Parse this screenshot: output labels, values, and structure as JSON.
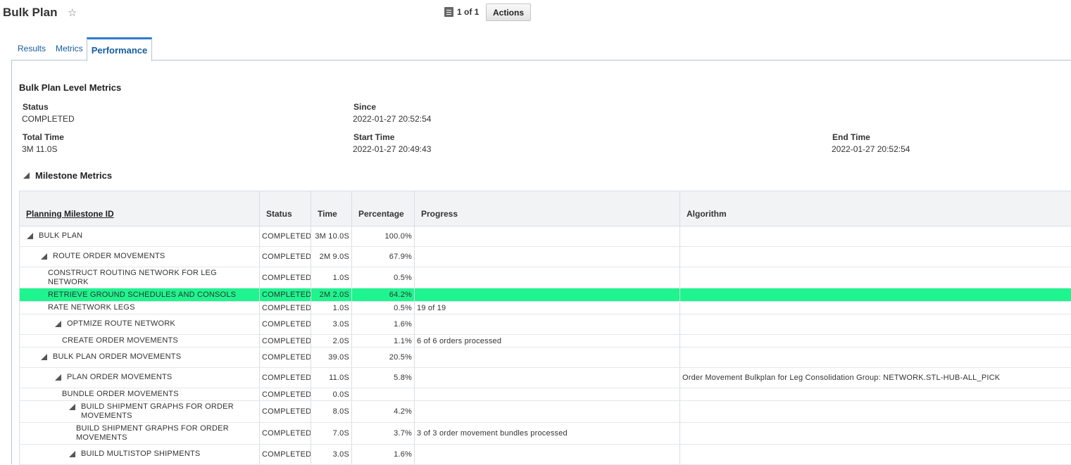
{
  "header": {
    "title": "Bulk Plan",
    "pager_text": "1 of 1",
    "actions_label": "Actions"
  },
  "tabs": [
    {
      "label": "Results",
      "active": false
    },
    {
      "label": "Metrics",
      "active": false
    },
    {
      "label": "Performance",
      "active": true
    }
  ],
  "bulk_plan_metrics": {
    "title": "Bulk Plan Level Metrics",
    "status_label": "Status",
    "status_value": "COMPLETED",
    "since_label": "Since",
    "since_value": "2022-01-27 20:52:54",
    "total_time_label": "Total Time",
    "total_time_value": "3M 11.0S",
    "start_time_label": "Start Time",
    "start_time_value": "2022-01-27 20:49:43",
    "end_time_label": "End Time",
    "end_time_value": "2022-01-27 20:52:54"
  },
  "milestone": {
    "title": "Milestone Metrics",
    "columns": [
      "Planning Milestone ID",
      "Status",
      "Time",
      "Percentage",
      "Progress",
      "Algorithm"
    ],
    "rows": [
      {
        "id": "BULK PLAN",
        "level": 0,
        "expandable": true,
        "status": "COMPLETED",
        "time": "3M 10.0S",
        "percentage": "100.0%",
        "progress": "",
        "algorithm": "",
        "highlight": false
      },
      {
        "id": "ROUTE ORDER MOVEMENTS",
        "level": 1,
        "expandable": true,
        "status": "COMPLETED",
        "time": "2M 9.0S",
        "percentage": "67.9%",
        "progress": "",
        "algorithm": "",
        "highlight": false
      },
      {
        "id": "CONSTRUCT ROUTING NETWORK FOR LEG NETWORK",
        "level": 2,
        "expandable": false,
        "status": "COMPLETED",
        "time": "1.0S",
        "percentage": "0.5%",
        "progress": "",
        "algorithm": "",
        "highlight": false
      },
      {
        "id": "RETRIEVE GROUND SCHEDULES AND CONSOLS",
        "level": 2,
        "expandable": false,
        "status": "COMPLETED",
        "time": "2M 2.0S",
        "percentage": "64.2%",
        "progress": "",
        "algorithm": "",
        "highlight": true
      },
      {
        "id": "RATE NETWORK LEGS",
        "level": 2,
        "expandable": false,
        "status": "COMPLETED",
        "time": "1.0S",
        "percentage": "0.5%",
        "progress": "19 of 19",
        "algorithm": "",
        "highlight": false
      },
      {
        "id": "OPTMIZE ROUTE NETWORK",
        "level": 2,
        "expandable": true,
        "status": "COMPLETED",
        "time": "3.0S",
        "percentage": "1.6%",
        "progress": "",
        "algorithm": "",
        "highlight": false
      },
      {
        "id": "CREATE ORDER MOVEMENTS",
        "level": 3,
        "expandable": false,
        "status": "COMPLETED",
        "time": "2.0S",
        "percentage": "1.1%",
        "progress": "6 of 6 orders processed",
        "algorithm": "",
        "highlight": false
      },
      {
        "id": "BULK PLAN ORDER MOVEMENTS",
        "level": 1,
        "expandable": true,
        "status": "COMPLETED",
        "time": "39.0S",
        "percentage": "20.5%",
        "progress": "",
        "algorithm": "",
        "highlight": false
      },
      {
        "id": "PLAN ORDER MOVEMENTS",
        "level": 2,
        "expandable": true,
        "status": "COMPLETED",
        "time": "11.0S",
        "percentage": "5.8%",
        "progress": "",
        "algorithm": "Order Movement Bulkplan for Leg Consolidation Group: NETWORK.STL-HUB-ALL_PICK",
        "highlight": false
      },
      {
        "id": "BUNDLE ORDER MOVEMENTS",
        "level": 3,
        "expandable": false,
        "status": "COMPLETED",
        "time": "0.0S",
        "percentage": "",
        "progress": "",
        "algorithm": "",
        "highlight": false
      },
      {
        "id": "BUILD SHIPMENT GRAPHS FOR ORDER MOVEMENTS",
        "level": 3,
        "expandable": true,
        "status": "COMPLETED",
        "time": "8.0S",
        "percentage": "4.2%",
        "progress": "",
        "algorithm": "",
        "highlight": false
      },
      {
        "id": "BUILD SHIPMENT GRAPHS FOR ORDER MOVEMENTS",
        "level": 4,
        "expandable": false,
        "status": "COMPLETED",
        "time": "7.0S",
        "percentage": "3.7%",
        "progress": "3 of 3 order movement bundles processed",
        "algorithm": "",
        "highlight": false
      },
      {
        "id": "BUILD MULTISTOP SHIPMENTS",
        "level": 3,
        "expandable": true,
        "status": "COMPLETED",
        "time": "3.0S",
        "percentage": "1.6%",
        "progress": "",
        "algorithm": "",
        "highlight": false
      }
    ]
  },
  "colors": {
    "highlight_row": "#1ef58e",
    "link": "#145c9e",
    "tab_accent": "#2e7bcf"
  }
}
